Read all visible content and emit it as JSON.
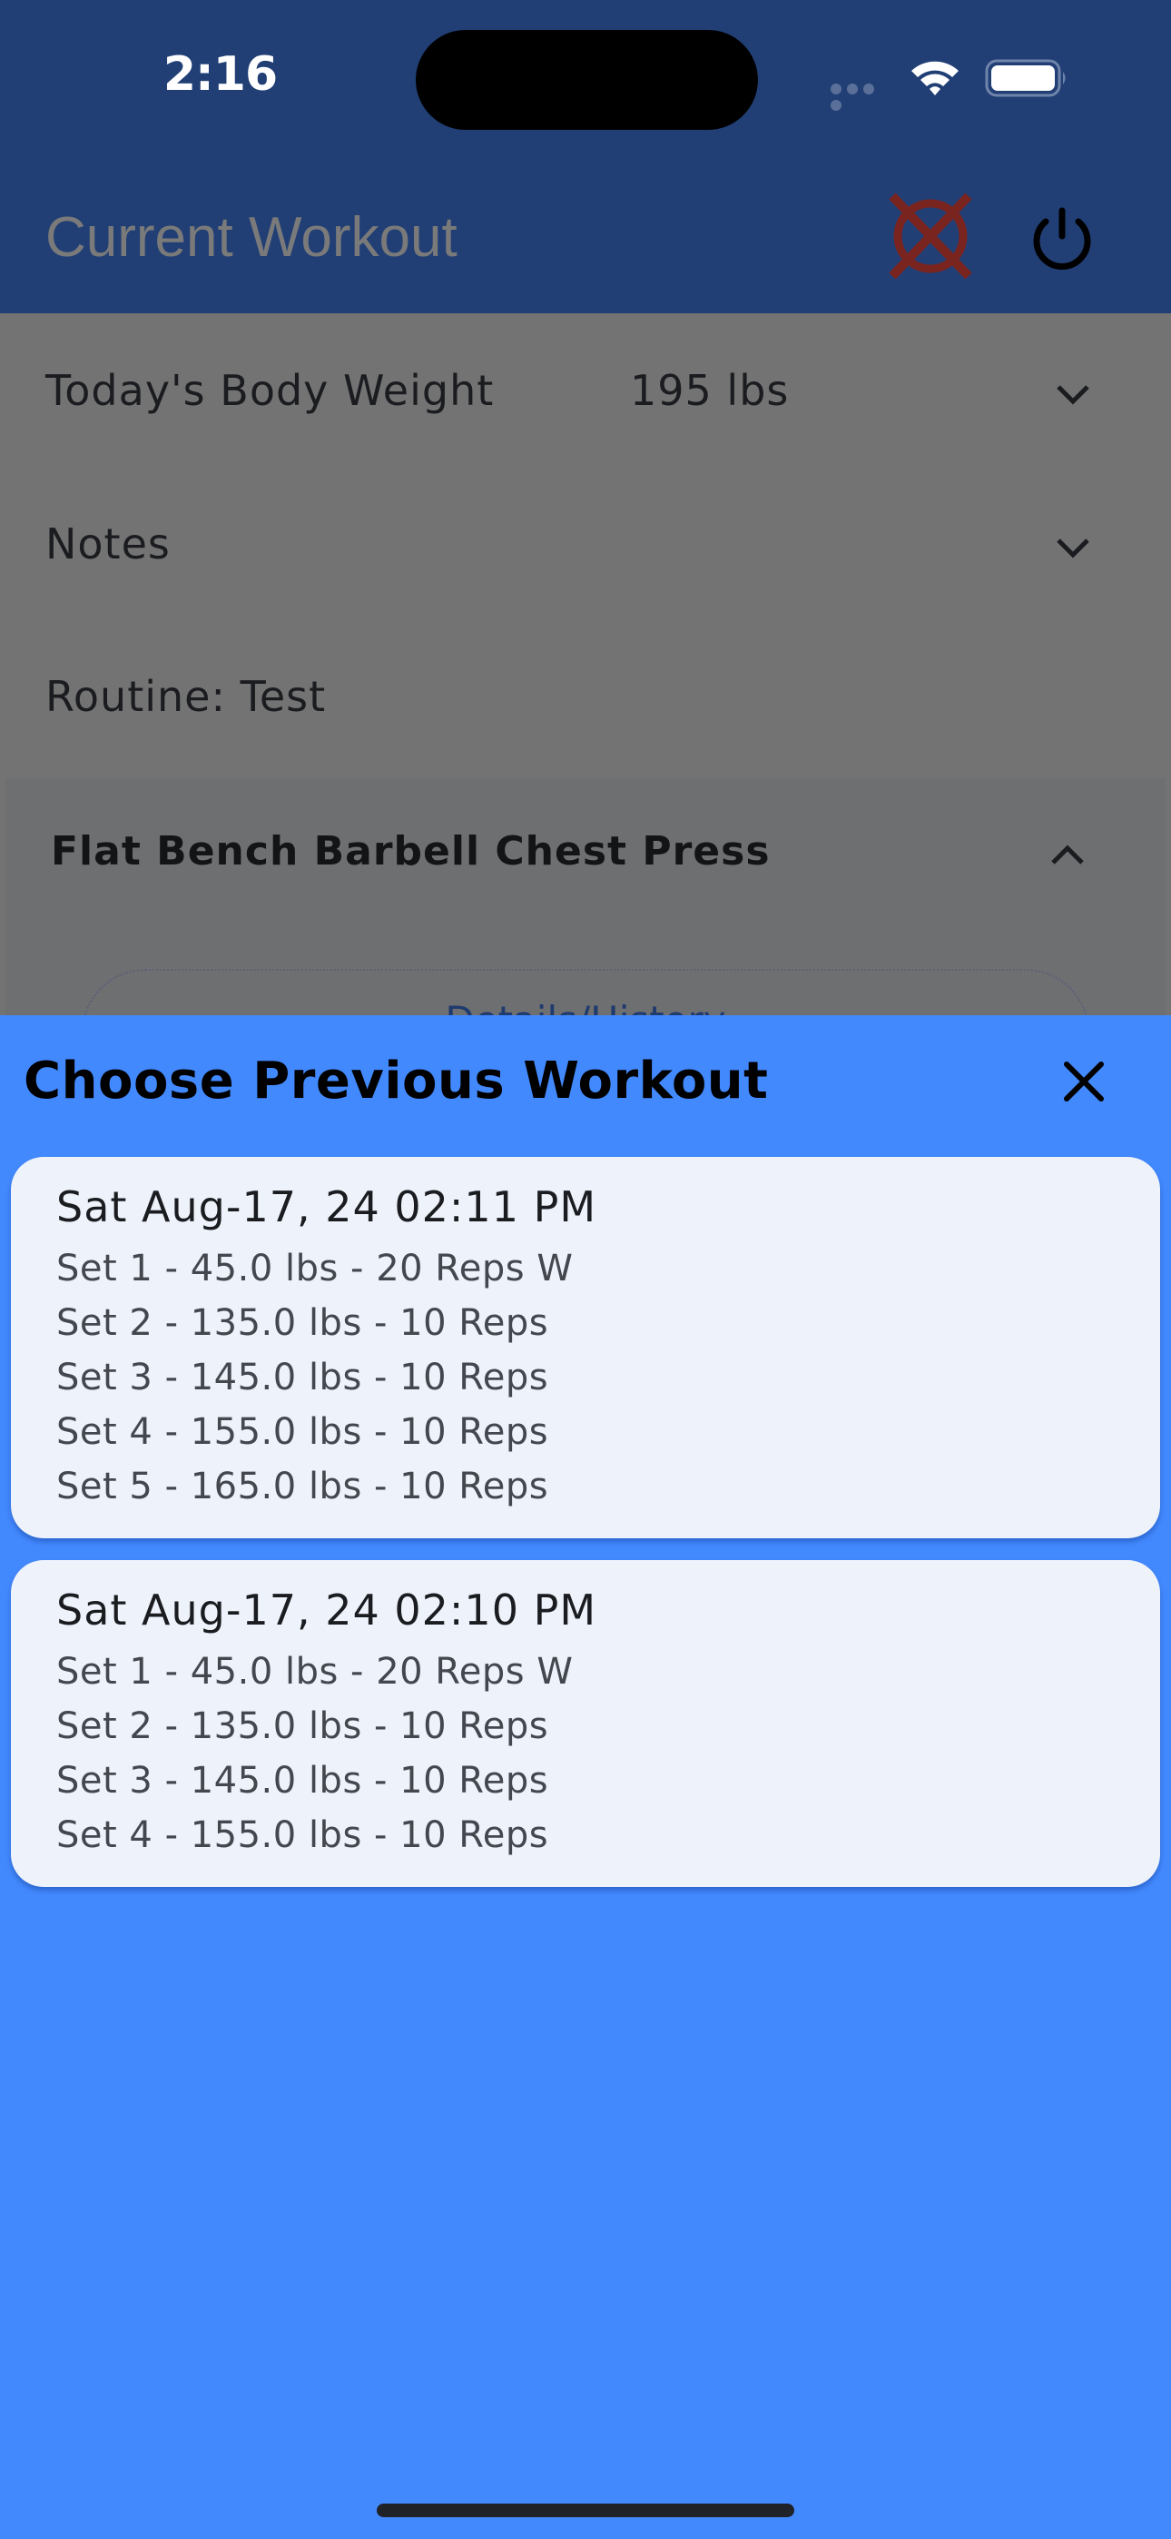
{
  "status_bar": {
    "time": "2:16",
    "wifi_icon": "wifi-icon",
    "battery_icon": "battery-icon"
  },
  "app_bar": {
    "title": "Current Workout",
    "cancel_icon": "cancel-workout-icon",
    "power_icon": "power-icon"
  },
  "rows": {
    "body_weight_label": "Today's Body Weight",
    "body_weight_value": "195 lbs",
    "notes_label": "Notes",
    "routine_label": "Routine: Test"
  },
  "exercise": {
    "title": "Flat Bench Barbell Chest Press",
    "details_button": "Details/History"
  },
  "sheet": {
    "title": "Choose Previous Workout",
    "close_icon": "close-icon",
    "workouts": [
      {
        "date": "Sat Aug-17, 24 02:11 PM",
        "sets": [
          "Set 1 - 45.0 lbs - 20 Reps W",
          "Set 2 - 135.0 lbs - 10 Reps",
          "Set 3 - 145.0 lbs - 10 Reps",
          "Set 4 - 155.0 lbs - 10 Reps",
          "Set 5 - 165.0 lbs - 10 Reps"
        ]
      },
      {
        "date": "Sat Aug-17, 24 02:10 PM",
        "sets": [
          "Set 1 - 45.0 lbs - 20 Reps W",
          "Set 2 - 135.0 lbs - 10 Reps",
          "Set 3 - 145.0 lbs - 10 Reps",
          "Set 4 - 155.0 lbs - 10 Reps"
        ]
      }
    ]
  },
  "colors": {
    "app_bar": "#213F75",
    "scrim": "#737373",
    "sheet": "#4389FE",
    "card": "#EEF3FB",
    "cancel_icon": "#7A2420"
  }
}
